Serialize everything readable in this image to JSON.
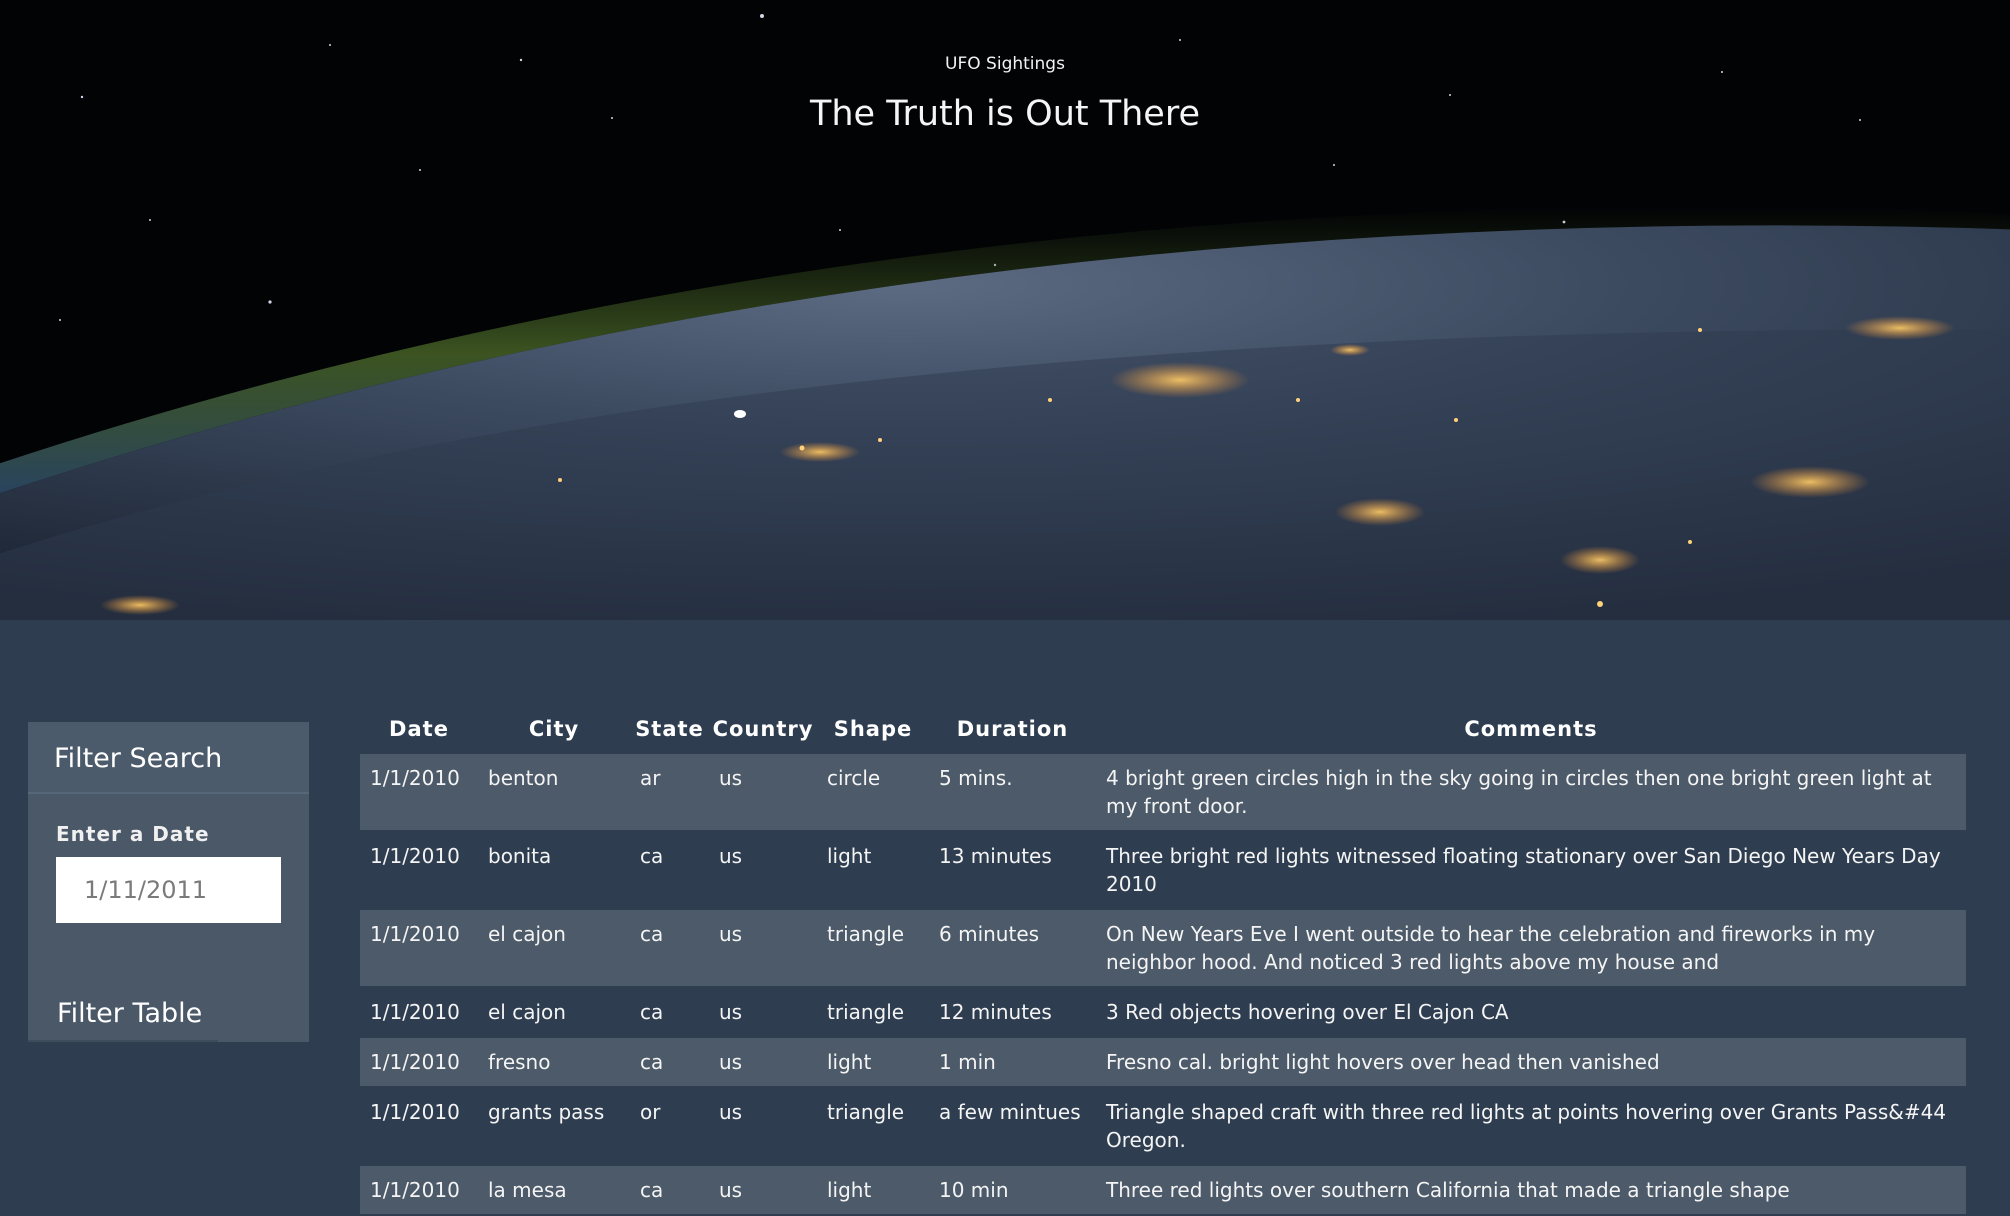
{
  "header": {
    "brand": "UFO Sightings",
    "tagline": "The Truth is Out There"
  },
  "filter": {
    "title": "Filter Search",
    "date_label": "Enter a Date",
    "date_placeholder": "1/11/2011",
    "button_label": "Filter Table"
  },
  "table": {
    "columns": [
      "Date",
      "City",
      "State",
      "Country",
      "Shape",
      "Duration",
      "Comments"
    ],
    "rows": [
      [
        "1/1/2010",
        "benton",
        "ar",
        "us",
        "circle",
        "5 mins.",
        "4 bright green circles high in the sky going in circles then one bright green light at my front door."
      ],
      [
        "1/1/2010",
        "bonita",
        "ca",
        "us",
        "light",
        "13 minutes",
        "Three bright red lights witnessed floating stationary over San Diego New Years Day 2010"
      ],
      [
        "1/1/2010",
        "el cajon",
        "ca",
        "us",
        "triangle",
        "6 minutes",
        "On New Years Eve I went outside to hear the celebration and fireworks in my neighbor hood. And noticed 3 red lights above my house and"
      ],
      [
        "1/1/2010",
        "el cajon",
        "ca",
        "us",
        "triangle",
        "12 minutes",
        "3 Red objects hovering over El Cajon CA"
      ],
      [
        "1/1/2010",
        "fresno",
        "ca",
        "us",
        "light",
        "1 min",
        "Fresno cal. bright light hovers over head then vanished"
      ],
      [
        "1/1/2010",
        "grants pass",
        "or",
        "us",
        "triangle",
        "a few mintues",
        "Triangle shaped craft with three red lights at points hovering over Grants Pass&#44 Oregon."
      ],
      [
        "1/1/2010",
        "la mesa",
        "ca",
        "us",
        "light",
        "10 min",
        "Three red lights over southern California that made a triangle shape"
      ]
    ]
  },
  "colors": {
    "page_background": "#2e3e50",
    "row_stripe": "#4c5a69",
    "panel": "#4a5868"
  }
}
